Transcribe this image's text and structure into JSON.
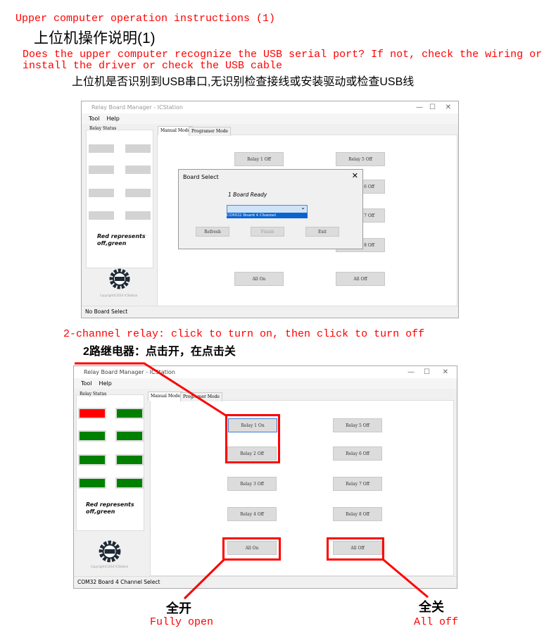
{
  "heading1": {
    "en": "Upper computer operation instructions (1)",
    "cn": "上位机操作说明(1)"
  },
  "heading2": {
    "en_line1": "Does the upper computer recognize the USB serial port? If not, check the wiring or",
    "en_line2": "install the driver or check the USB cable",
    "cn": "上位机是否识别到USB串口,无识别检查接线或安装驱动或检查USB线"
  },
  "window1": {
    "title": "Relay Board Manager - ICStation",
    "menu": [
      "Tool",
      "Help"
    ],
    "relay_status_label": "Relay Status",
    "tabs": [
      "Manual Mode",
      "Programer Mode"
    ],
    "buttons": [
      "Relay 1 Off",
      "Relay 5 Off",
      "6 Off",
      "7 Off",
      "8 Off",
      "All On",
      "All Off"
    ],
    "note": "Red represents off,green",
    "copyright": "Copyright©2014 ICStation",
    "status": "No Board Select",
    "dialog": {
      "title": "Board Select",
      "message": "1 Board Ready",
      "dropdown_value": "",
      "dropdown_option": "COM32 Board 4 Channel",
      "buttons": [
        "Refresh",
        "Finish",
        "Exit"
      ]
    }
  },
  "section2": {
    "en": "2-channel relay: click to turn on, then click to turn off",
    "cn": "2路继电器：点击开，在点击关"
  },
  "window2": {
    "title": "Relay Board Manager - ICStation",
    "menu": [
      "Tool",
      "Help"
    ],
    "relay_status_label": "Relay Status",
    "tabs": [
      "Manual Mode",
      "Programer Mode"
    ],
    "leds": [
      "red",
      "green",
      "green",
      "green",
      "green",
      "green",
      "green",
      "green"
    ],
    "buttons": [
      "Relay 1 On",
      "Relay 2 Off",
      "Relay 3 Off",
      "Relay 4 Off",
      "Relay 5 Off",
      "Relay 6 Off",
      "Relay 7 Off",
      "Relay 8 Off",
      "All On",
      "All Off"
    ],
    "note": "Red represents off,green",
    "copyright": "Copyright©2014 ICStation",
    "status": "COM32 Board 4 Channel Select"
  },
  "labels": {
    "all_on_cn": "全开",
    "all_on_en": "Fully open",
    "all_off_cn": "全关",
    "all_off_en": "All off"
  },
  "colors": {
    "annotation": "#ff0000",
    "led_on": "#ff0000",
    "led_off": "#008000"
  }
}
